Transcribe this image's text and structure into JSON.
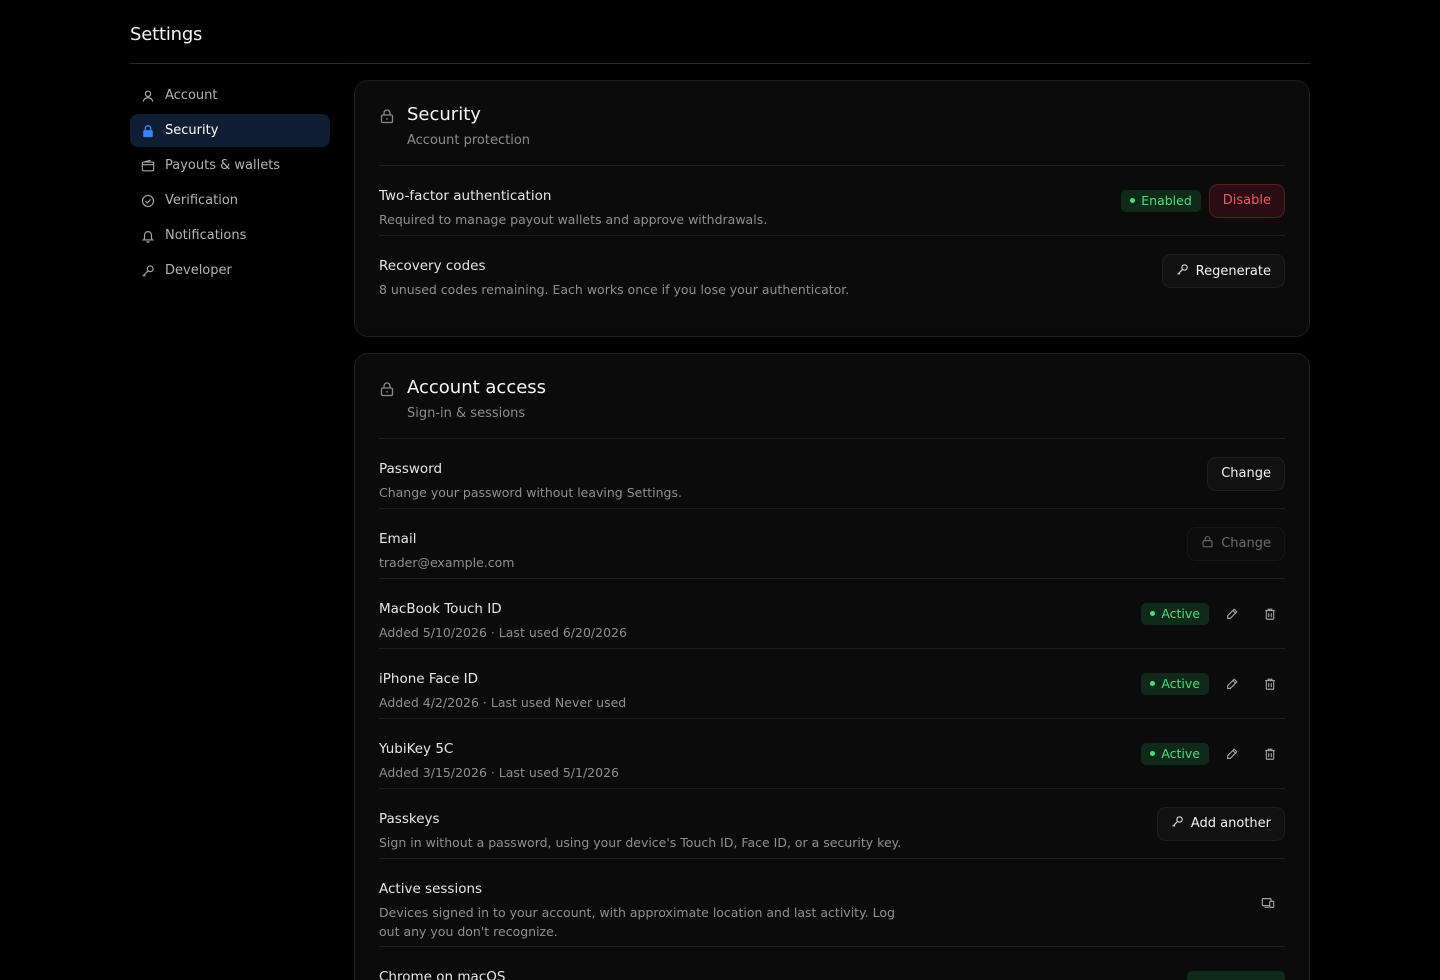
{
  "page": {
    "title": "Settings"
  },
  "sidebar": {
    "items": [
      {
        "label": "Account",
        "icon": "user-icon",
        "active": false
      },
      {
        "label": "Security",
        "icon": "lock-icon",
        "active": true
      },
      {
        "label": "Payouts & wallets",
        "icon": "wallet-icon",
        "active": false
      },
      {
        "label": "Verification",
        "icon": "check-badge-icon",
        "active": false
      },
      {
        "label": "Notifications",
        "icon": "bell-icon",
        "active": false
      },
      {
        "label": "Developer",
        "icon": "key-icon",
        "active": false
      }
    ]
  },
  "security_card": {
    "title": "Security",
    "subtitle": "Account protection",
    "two_factor": {
      "title": "Two-factor authentication",
      "desc": "Required to manage payout wallets and approve withdrawals.",
      "status": "Enabled",
      "action": "Disable"
    },
    "recovery": {
      "title": "Recovery codes",
      "desc": "8 unused codes remaining. Each works once if you lose your authenticator.",
      "action": "Regenerate"
    }
  },
  "access_card": {
    "title": "Account access",
    "subtitle": "Sign-in & sessions",
    "password": {
      "title": "Password",
      "desc": "Change your password without leaving Settings.",
      "action": "Change"
    },
    "email": {
      "title": "Email",
      "value": "trader@example.com",
      "action": "Change"
    },
    "passkey_items": [
      {
        "title": "MacBook Touch ID",
        "desc": "Added 5/10/2026 · Last used 6/20/2026",
        "status": "Active"
      },
      {
        "title": "iPhone Face ID",
        "desc": "Added 4/2/2026 · Last used Never used",
        "status": "Active"
      },
      {
        "title": "YubiKey 5C",
        "desc": "Added 3/15/2026 · Last used 5/1/2026",
        "status": "Active"
      }
    ],
    "passkeys": {
      "title": "Passkeys",
      "desc": "Sign in without a password, using your device's Touch ID, Face ID, or a security key.",
      "action": "Add another"
    },
    "sessions": {
      "title": "Active sessions",
      "desc": "Devices signed in to your account, with approximate location and last activity. Log out any you don't recognize."
    },
    "session_item": {
      "title": "Chrome on macOS"
    }
  },
  "colors": {
    "accent": "#2f6fed",
    "active_nav_bg": "#0f1e33",
    "success": "#4ade80",
    "danger": "#f0566a"
  }
}
